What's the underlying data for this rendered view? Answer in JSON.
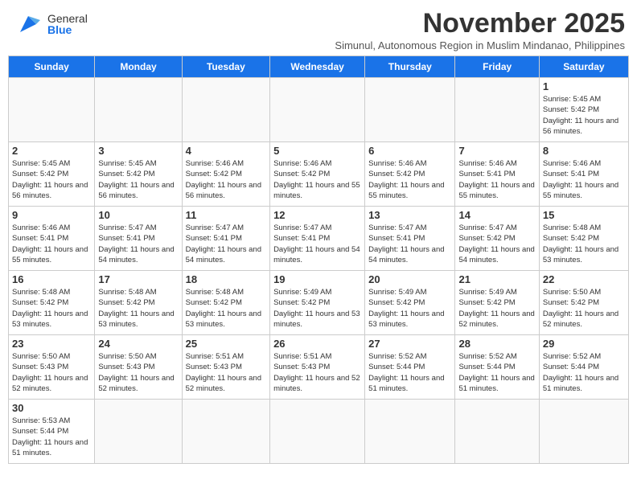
{
  "header": {
    "logo_text_general": "General",
    "logo_text_blue": "Blue",
    "month_title": "November 2025",
    "subtitle": "Simunul, Autonomous Region in Muslim Mindanao, Philippines"
  },
  "days_of_week": [
    "Sunday",
    "Monday",
    "Tuesday",
    "Wednesday",
    "Thursday",
    "Friday",
    "Saturday"
  ],
  "weeks": [
    {
      "days": [
        {
          "num": "",
          "empty": true
        },
        {
          "num": "",
          "empty": true
        },
        {
          "num": "",
          "empty": true
        },
        {
          "num": "",
          "empty": true
        },
        {
          "num": "",
          "empty": true
        },
        {
          "num": "",
          "empty": true
        },
        {
          "num": "1",
          "sunrise": "Sunrise: 5:45 AM",
          "sunset": "Sunset: 5:42 PM",
          "daylight": "Daylight: 11 hours and 56 minutes."
        }
      ]
    },
    {
      "days": [
        {
          "num": "2",
          "sunrise": "Sunrise: 5:45 AM",
          "sunset": "Sunset: 5:42 PM",
          "daylight": "Daylight: 11 hours and 56 minutes."
        },
        {
          "num": "3",
          "sunrise": "Sunrise: 5:45 AM",
          "sunset": "Sunset: 5:42 PM",
          "daylight": "Daylight: 11 hours and 56 minutes."
        },
        {
          "num": "4",
          "sunrise": "Sunrise: 5:46 AM",
          "sunset": "Sunset: 5:42 PM",
          "daylight": "Daylight: 11 hours and 56 minutes."
        },
        {
          "num": "5",
          "sunrise": "Sunrise: 5:46 AM",
          "sunset": "Sunset: 5:42 PM",
          "daylight": "Daylight: 11 hours and 55 minutes."
        },
        {
          "num": "6",
          "sunrise": "Sunrise: 5:46 AM",
          "sunset": "Sunset: 5:42 PM",
          "daylight": "Daylight: 11 hours and 55 minutes."
        },
        {
          "num": "7",
          "sunrise": "Sunrise: 5:46 AM",
          "sunset": "Sunset: 5:41 PM",
          "daylight": "Daylight: 11 hours and 55 minutes."
        },
        {
          "num": "8",
          "sunrise": "Sunrise: 5:46 AM",
          "sunset": "Sunset: 5:41 PM",
          "daylight": "Daylight: 11 hours and 55 minutes."
        }
      ]
    },
    {
      "days": [
        {
          "num": "9",
          "sunrise": "Sunrise: 5:46 AM",
          "sunset": "Sunset: 5:41 PM",
          "daylight": "Daylight: 11 hours and 55 minutes."
        },
        {
          "num": "10",
          "sunrise": "Sunrise: 5:47 AM",
          "sunset": "Sunset: 5:41 PM",
          "daylight": "Daylight: 11 hours and 54 minutes."
        },
        {
          "num": "11",
          "sunrise": "Sunrise: 5:47 AM",
          "sunset": "Sunset: 5:41 PM",
          "daylight": "Daylight: 11 hours and 54 minutes."
        },
        {
          "num": "12",
          "sunrise": "Sunrise: 5:47 AM",
          "sunset": "Sunset: 5:41 PM",
          "daylight": "Daylight: 11 hours and 54 minutes."
        },
        {
          "num": "13",
          "sunrise": "Sunrise: 5:47 AM",
          "sunset": "Sunset: 5:41 PM",
          "daylight": "Daylight: 11 hours and 54 minutes."
        },
        {
          "num": "14",
          "sunrise": "Sunrise: 5:47 AM",
          "sunset": "Sunset: 5:42 PM",
          "daylight": "Daylight: 11 hours and 54 minutes."
        },
        {
          "num": "15",
          "sunrise": "Sunrise: 5:48 AM",
          "sunset": "Sunset: 5:42 PM",
          "daylight": "Daylight: 11 hours and 53 minutes."
        }
      ]
    },
    {
      "days": [
        {
          "num": "16",
          "sunrise": "Sunrise: 5:48 AM",
          "sunset": "Sunset: 5:42 PM",
          "daylight": "Daylight: 11 hours and 53 minutes."
        },
        {
          "num": "17",
          "sunrise": "Sunrise: 5:48 AM",
          "sunset": "Sunset: 5:42 PM",
          "daylight": "Daylight: 11 hours and 53 minutes."
        },
        {
          "num": "18",
          "sunrise": "Sunrise: 5:48 AM",
          "sunset": "Sunset: 5:42 PM",
          "daylight": "Daylight: 11 hours and 53 minutes."
        },
        {
          "num": "19",
          "sunrise": "Sunrise: 5:49 AM",
          "sunset": "Sunset: 5:42 PM",
          "daylight": "Daylight: 11 hours and 53 minutes."
        },
        {
          "num": "20",
          "sunrise": "Sunrise: 5:49 AM",
          "sunset": "Sunset: 5:42 PM",
          "daylight": "Daylight: 11 hours and 53 minutes."
        },
        {
          "num": "21",
          "sunrise": "Sunrise: 5:49 AM",
          "sunset": "Sunset: 5:42 PM",
          "daylight": "Daylight: 11 hours and 52 minutes."
        },
        {
          "num": "22",
          "sunrise": "Sunrise: 5:50 AM",
          "sunset": "Sunset: 5:42 PM",
          "daylight": "Daylight: 11 hours and 52 minutes."
        }
      ]
    },
    {
      "days": [
        {
          "num": "23",
          "sunrise": "Sunrise: 5:50 AM",
          "sunset": "Sunset: 5:43 PM",
          "daylight": "Daylight: 11 hours and 52 minutes."
        },
        {
          "num": "24",
          "sunrise": "Sunrise: 5:50 AM",
          "sunset": "Sunset: 5:43 PM",
          "daylight": "Daylight: 11 hours and 52 minutes."
        },
        {
          "num": "25",
          "sunrise": "Sunrise: 5:51 AM",
          "sunset": "Sunset: 5:43 PM",
          "daylight": "Daylight: 11 hours and 52 minutes."
        },
        {
          "num": "26",
          "sunrise": "Sunrise: 5:51 AM",
          "sunset": "Sunset: 5:43 PM",
          "daylight": "Daylight: 11 hours and 52 minutes."
        },
        {
          "num": "27",
          "sunrise": "Sunrise: 5:52 AM",
          "sunset": "Sunset: 5:44 PM",
          "daylight": "Daylight: 11 hours and 51 minutes."
        },
        {
          "num": "28",
          "sunrise": "Sunrise: 5:52 AM",
          "sunset": "Sunset: 5:44 PM",
          "daylight": "Daylight: 11 hours and 51 minutes."
        },
        {
          "num": "29",
          "sunrise": "Sunrise: 5:52 AM",
          "sunset": "Sunset: 5:44 PM",
          "daylight": "Daylight: 11 hours and 51 minutes."
        }
      ]
    },
    {
      "days": [
        {
          "num": "30",
          "sunrise": "Sunrise: 5:53 AM",
          "sunset": "Sunset: 5:44 PM",
          "daylight": "Daylight: 11 hours and 51 minutes."
        },
        {
          "num": "",
          "empty": true
        },
        {
          "num": "",
          "empty": true
        },
        {
          "num": "",
          "empty": true
        },
        {
          "num": "",
          "empty": true
        },
        {
          "num": "",
          "empty": true
        },
        {
          "num": "",
          "empty": true
        }
      ]
    }
  ]
}
